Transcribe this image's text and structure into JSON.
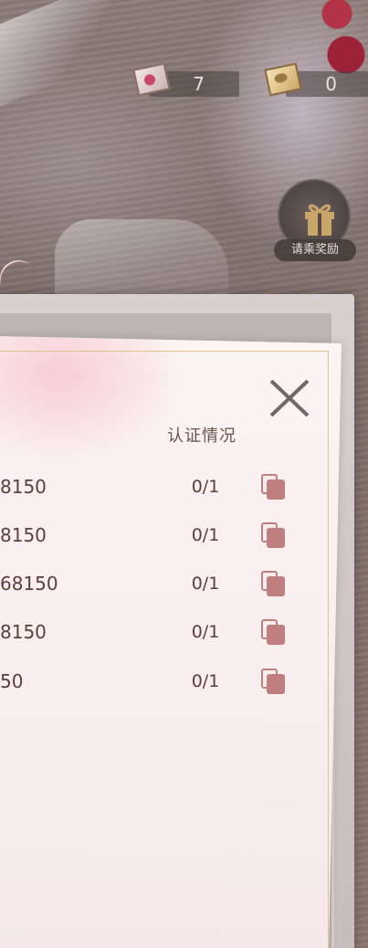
{
  "currencies": [
    {
      "icon": "pink-letter-icon",
      "value": "7"
    },
    {
      "icon": "gold-letter-icon",
      "value": "0"
    }
  ],
  "gift": {
    "icon": "gift-box-icon",
    "label": "请乘奖励"
  },
  "table": {
    "header": "认证情况",
    "rows": [
      {
        "id": "8150",
        "status": "0/1"
      },
      {
        "id": "8150",
        "status": "0/1"
      },
      {
        "id": "68150",
        "status": "0/1"
      },
      {
        "id": "8150",
        "status": "0/1"
      },
      {
        "id": "50",
        "status": "0/1"
      }
    ]
  },
  "colors": {
    "accent": "#c07f7f",
    "text": "#5e3f36",
    "paper": "#fbf3f4",
    "frame_gold": "#e2c28f"
  }
}
